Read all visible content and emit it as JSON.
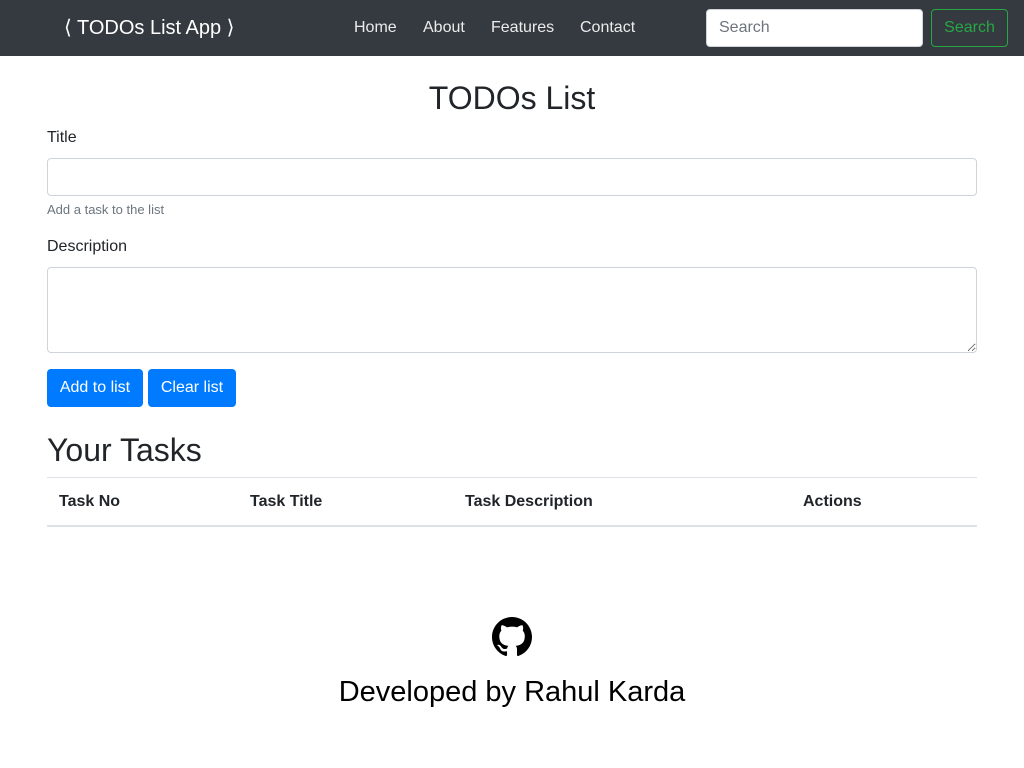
{
  "navbar": {
    "brand": "⟨ TODOs List App ⟩",
    "links": [
      "Home",
      "About",
      "Features",
      "Contact"
    ],
    "search_placeholder": "Search",
    "search_button": "Search"
  },
  "main": {
    "title": "TODOs List",
    "form": {
      "title_label": "Title",
      "title_value": "",
      "title_help": "Add a task to the list",
      "description_label": "Description",
      "description_value": "",
      "add_button": "Add to list",
      "clear_button": "Clear list"
    },
    "tasks": {
      "heading": "Your Tasks",
      "columns": [
        "Task No",
        "Task Title",
        "Task Description",
        "Actions"
      ],
      "rows": []
    }
  },
  "footer": {
    "icon": "github-icon",
    "text": "Developed by Rahul Karda"
  },
  "colors": {
    "navbar_bg": "#343a40",
    "primary": "#007bff",
    "success": "#28a745"
  }
}
